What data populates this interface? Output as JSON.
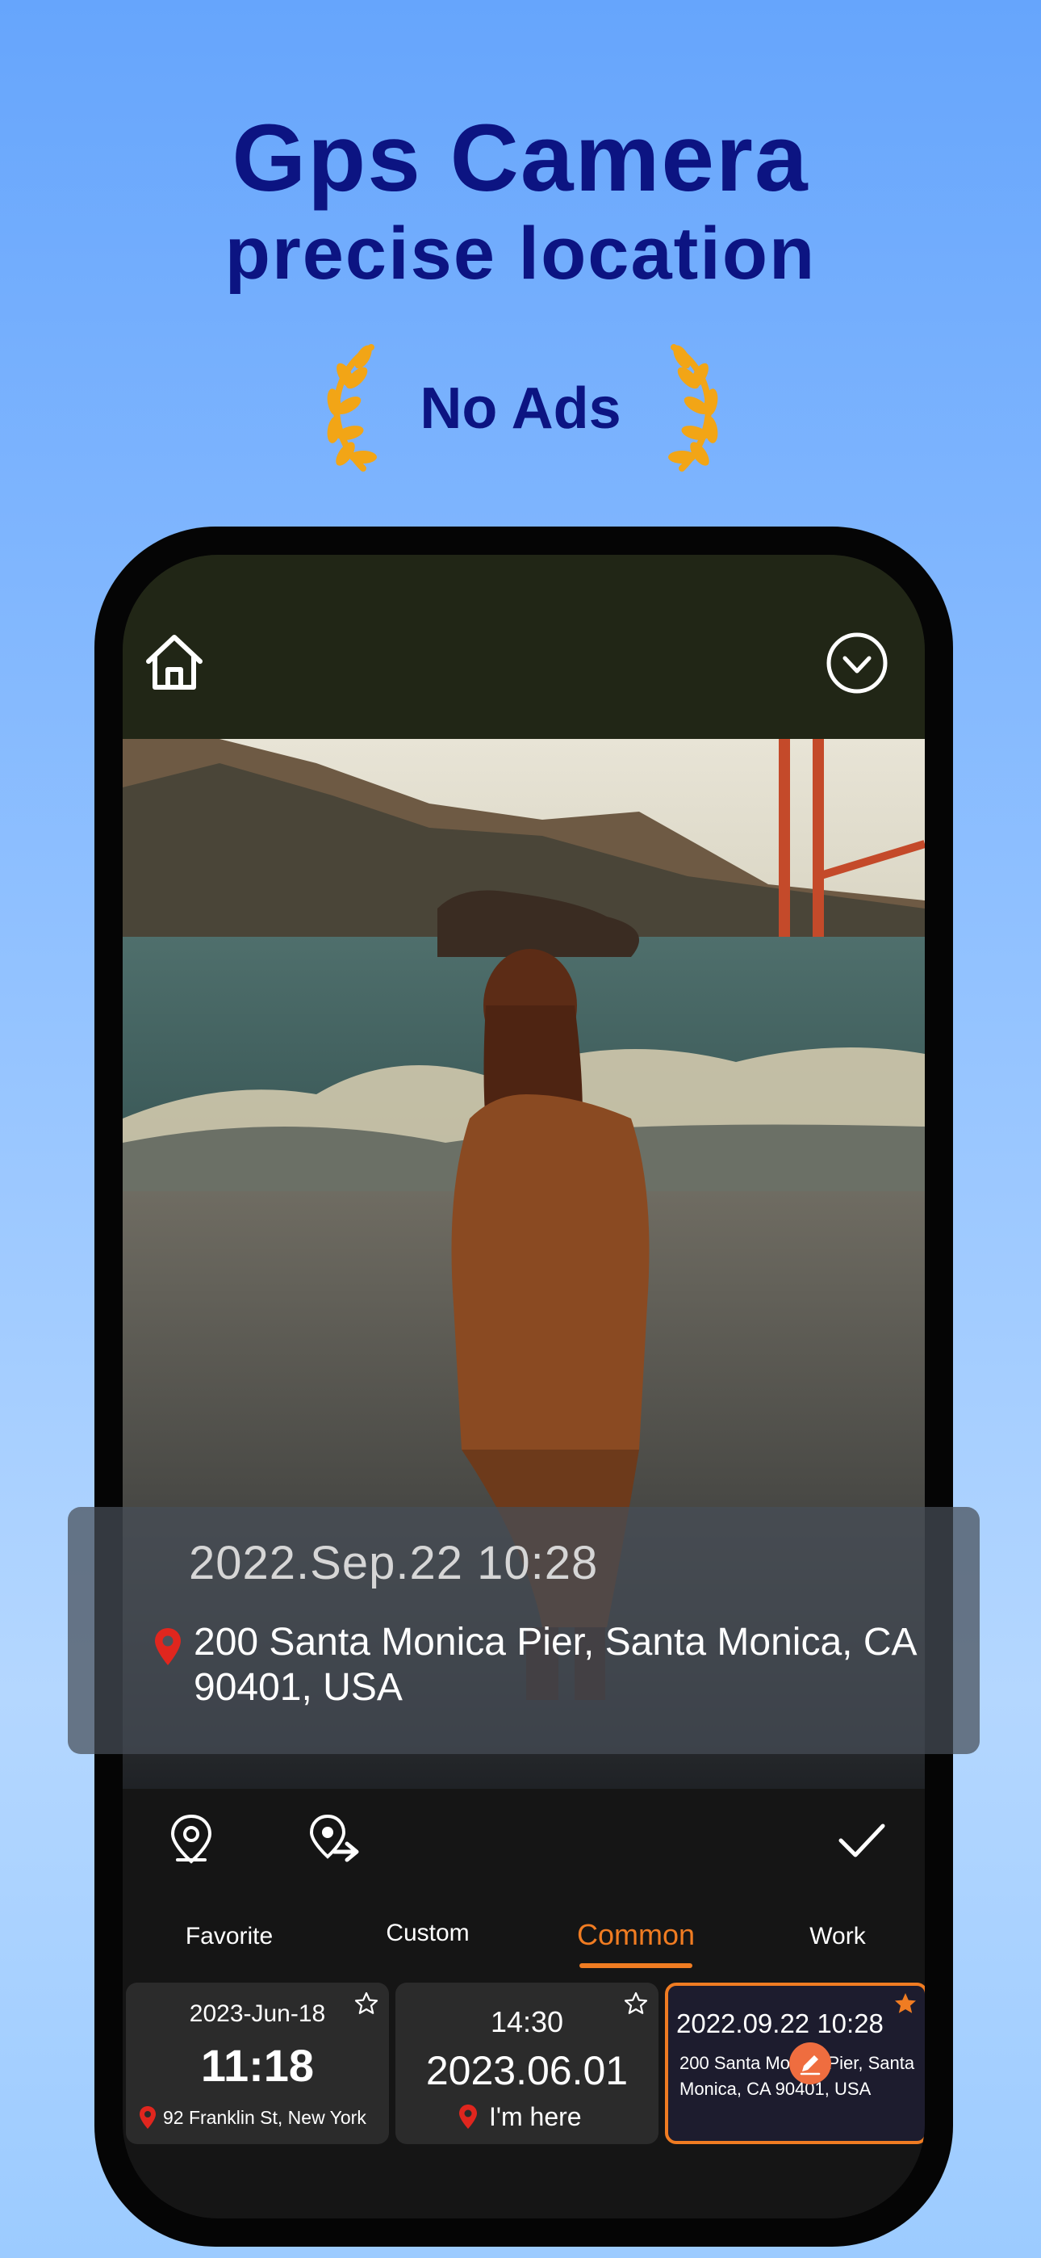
{
  "promo": {
    "headline_line1": "Gps Camera",
    "headline_line2": "precise location",
    "badge": "No Ads"
  },
  "topbar": {
    "home_icon": "home-icon",
    "confirm_icon": "check-circle-icon"
  },
  "stamp": {
    "date_time": "2022.Sep.22  10:28",
    "address": "200 Santa Monica Pier, Santa Monica, CA 90401, USA",
    "pin_icon": "location-pin-icon"
  },
  "toolbar": {
    "icons": [
      "location-pin-icon",
      "location-share-icon",
      "checkmark-icon"
    ]
  },
  "tabs": [
    {
      "label": "Favorite",
      "active": false
    },
    {
      "label": "Custom",
      "active": false
    },
    {
      "label": "Common",
      "active": true
    },
    {
      "label": "Work",
      "active": false
    }
  ],
  "cards": [
    {
      "date": "2023-Jun-18",
      "time": "11:18",
      "address": "92 Franklin St, New York",
      "selected": false
    },
    {
      "time": "14:30",
      "date": "2023.06.01",
      "location": "I'm here",
      "selected": false
    },
    {
      "date_time": "2022.09.22  10:28",
      "address": "200 Santa Monica Pier, Santa Monica, CA 90401, USA",
      "selected": true
    }
  ],
  "colors": {
    "accent": "#f07c22",
    "headline": "#0c1482",
    "pin": "#e0261e",
    "laurel": "#f2a516"
  }
}
